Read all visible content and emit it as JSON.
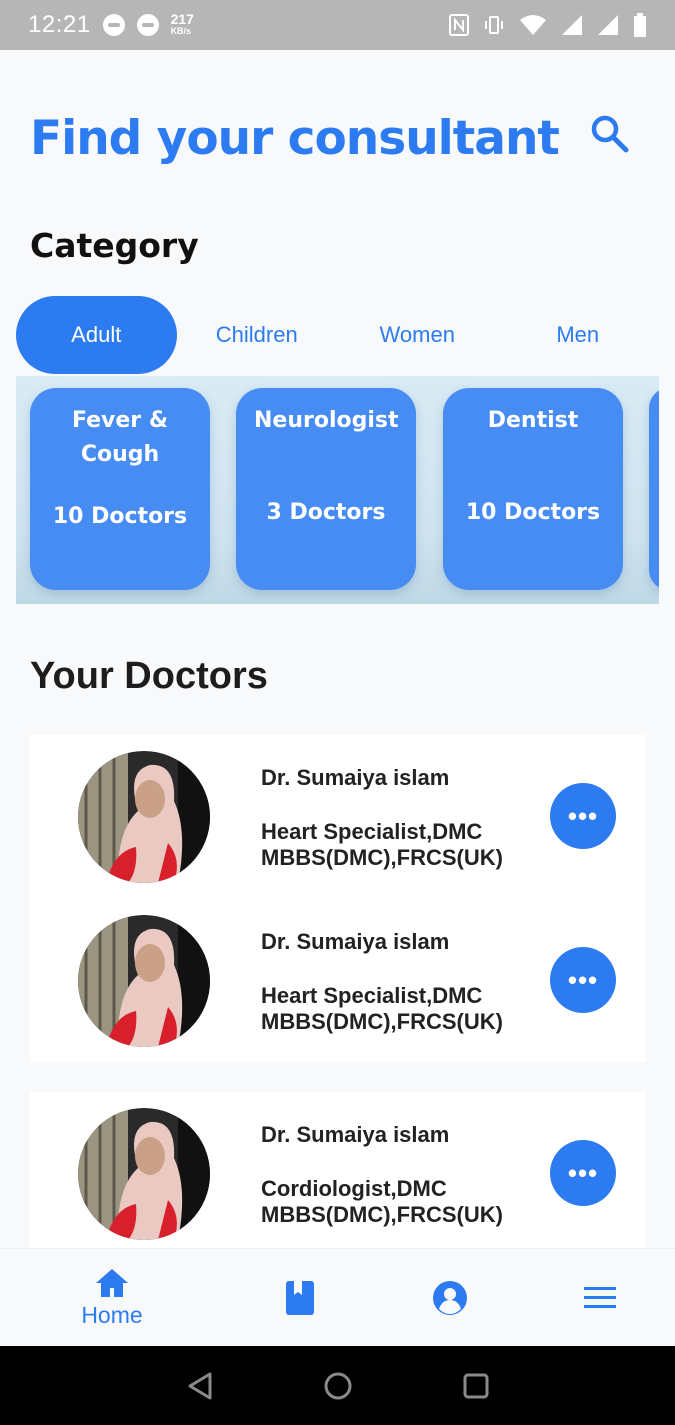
{
  "status_bar": {
    "time": "12:21",
    "speed_value": "217",
    "speed_unit": "KB/s",
    "left_icons": [
      "messenger-icon",
      "imo-icon"
    ],
    "right_icons": [
      "nfc-icon",
      "vibrate-icon",
      "wifi-icon",
      "signal-icon",
      "signal-icon",
      "battery-icon"
    ]
  },
  "header": {
    "title": "Find your consultant",
    "search_icon": "search-icon"
  },
  "category": {
    "title": "Category",
    "tabs": [
      {
        "label": "Adult",
        "active": true
      },
      {
        "label": "Children",
        "active": false
      },
      {
        "label": "Women",
        "active": false
      },
      {
        "label": "Men",
        "active": false
      }
    ],
    "cards": [
      {
        "name": "Fever & Cough",
        "count": "10 Doctors"
      },
      {
        "name": "Neurologist",
        "count": "3 Doctors"
      },
      {
        "name": "Dentist",
        "count": "10 Doctors"
      }
    ]
  },
  "doctors": {
    "title": "Your Doctors",
    "items": [
      {
        "name": "Dr. Sumaiya islam",
        "specialty": "Heart Specialist,DMC",
        "degrees": "MBBS(DMC),FRCS(UK)"
      },
      {
        "name": "Dr. Sumaiya islam",
        "specialty": "Heart Specialist,DMC",
        "degrees": "MBBS(DMC),FRCS(UK)"
      },
      {
        "name": "Dr. Sumaiya islam",
        "specialty": "Cordiologist,DMC",
        "degrees": "MBBS(DMC),FRCS(UK)"
      }
    ],
    "more_label": "•••"
  },
  "bottom_nav": {
    "items": [
      {
        "icon": "home-icon",
        "label": "Home",
        "active": true
      },
      {
        "icon": "book-icon",
        "label": ""
      },
      {
        "icon": "profile-icon",
        "label": ""
      },
      {
        "icon": "menu-icon",
        "label": ""
      }
    ]
  },
  "system_nav": [
    "back-icon",
    "home-circle-icon",
    "recents-icon"
  ],
  "colors": {
    "accent": "#2d7bf0",
    "card": "#468cf3",
    "status_bar": "#b6b6b6"
  }
}
